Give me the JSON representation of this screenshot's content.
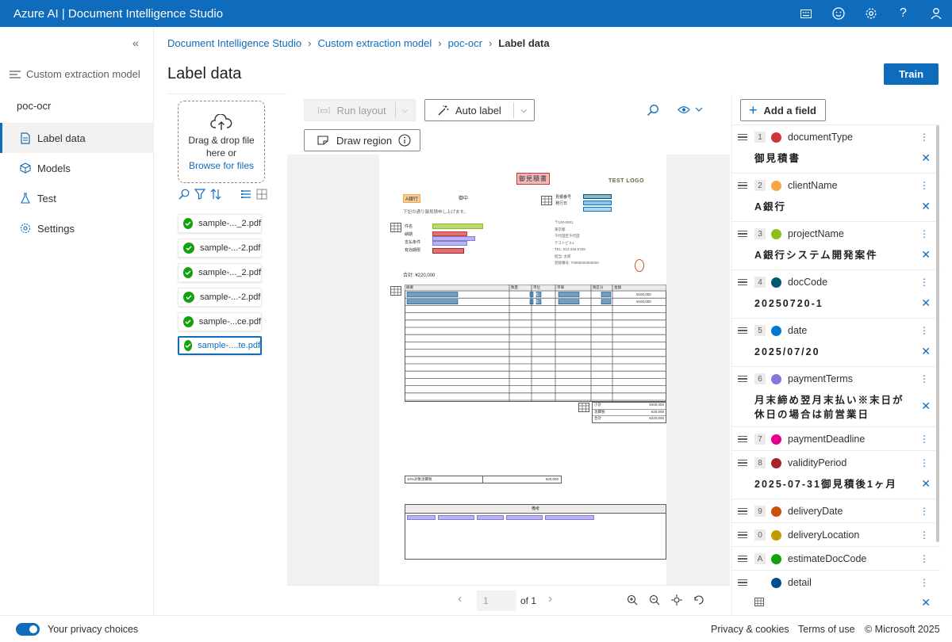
{
  "app": {
    "title": "Azure AI | Document Intelligence Studio"
  },
  "sidebar": {
    "collapse_icon": "«",
    "section": "Custom extraction model",
    "project": "poc-ocr",
    "items": [
      {
        "label": "Label data",
        "icon": "document-icon",
        "active": true
      },
      {
        "label": "Models",
        "icon": "cube-icon"
      },
      {
        "label": "Test",
        "icon": "flask-icon"
      },
      {
        "label": "Settings",
        "icon": "gear-icon"
      }
    ]
  },
  "breadcrumb": [
    "Document Intelligence Studio",
    "Custom extraction model",
    "poc-ocr",
    "Label data"
  ],
  "page_title": "Label data",
  "train_label": "Train",
  "files": {
    "drop_text": "Drag & drop file here or",
    "browse": "Browse for files",
    "items": [
      "sample-..._2.pdf",
      "sample-...-2.pdf",
      "sample-..._2.pdf",
      "sample-...-2.pdf",
      "sample-...ce.pdf",
      "sample-....te.pdf"
    ],
    "selected_index": 5
  },
  "viewer": {
    "run_layout": "Run layout",
    "auto_label": "Auto label",
    "draw_region": "Draw region",
    "page_number": "1",
    "page_of": "of 1"
  },
  "document": {
    "title_stamp": "御見積書",
    "logo": "TEST LOGO",
    "client": "A銀行",
    "honorific": "御中",
    "intro": "下記の通り御見積申し上げます。",
    "labels": [
      "件名",
      "納期",
      "支払条件",
      "有効期限"
    ],
    "doc_no_label": "見積番号",
    "date_label": "発行日",
    "sender": [
      "〒100-0001",
      "東京都",
      "千代田区千代田",
      "テストビル1",
      "TEL: 012-345-6789",
      "担当: 太郎",
      "登録番号: T0000000000000"
    ],
    "total": "合計: ¥220,000",
    "table_headers": [
      "摘要",
      "数量",
      "単位",
      "単価",
      "税区分",
      "金額"
    ],
    "table_rows": [
      [
        "",
        "1",
        "式",
        "",
        "",
        "¥100,000"
      ],
      [
        "",
        "1",
        "式",
        "",
        "",
        "¥100,000"
      ]
    ],
    "summary": [
      [
        "小計",
        "¥200,000"
      ],
      [
        "消費税",
        "¥20,000"
      ],
      [
        "合計",
        "¥220,000"
      ]
    ],
    "tax_label": "10%対象消費税",
    "tax_value": "¥20,000",
    "notes_header": "備考"
  },
  "fields": {
    "add_label": "Add a field",
    "items": [
      {
        "key": "1",
        "name": "documentType",
        "color": "#d13438",
        "value": "御見積書"
      },
      {
        "key": "2",
        "name": "clientName",
        "color": "#f7a645",
        "value": "A銀行"
      },
      {
        "key": "3",
        "name": "projectName",
        "color": "#8cbd18",
        "value": "A銀行システム開発案件"
      },
      {
        "key": "4",
        "name": "docCode",
        "color": "#005b70",
        "value": "20250720-1"
      },
      {
        "key": "5",
        "name": "date",
        "color": "#0078d4",
        "value": "2025/07/20"
      },
      {
        "key": "6",
        "name": "paymentTerms",
        "color": "#8378de",
        "value": "月末締め翌月末払い※末日が休日の場合は前営業日"
      },
      {
        "key": "7",
        "name": "paymentDeadline",
        "color": "#e3008c",
        "value": ""
      },
      {
        "key": "8",
        "name": "validityPeriod",
        "color": "#a4262c",
        "value": "2025-07-31御見積後1ヶ月"
      },
      {
        "key": "9",
        "name": "deliveryDate",
        "color": "#ca5010",
        "value": ""
      },
      {
        "key": "0",
        "name": "deliveryLocation",
        "color": "#c19c00",
        "value": ""
      },
      {
        "key": "A",
        "name": "estimateDocCode",
        "color": "#13a10e",
        "value": ""
      },
      {
        "key": "",
        "name": "detail",
        "color": "#004e8c",
        "value": ""
      }
    ]
  },
  "footer": {
    "privacy_choices": "Your privacy choices",
    "links": [
      "Privacy & cookies",
      "Terms of use",
      "© Microsoft 2025"
    ]
  }
}
